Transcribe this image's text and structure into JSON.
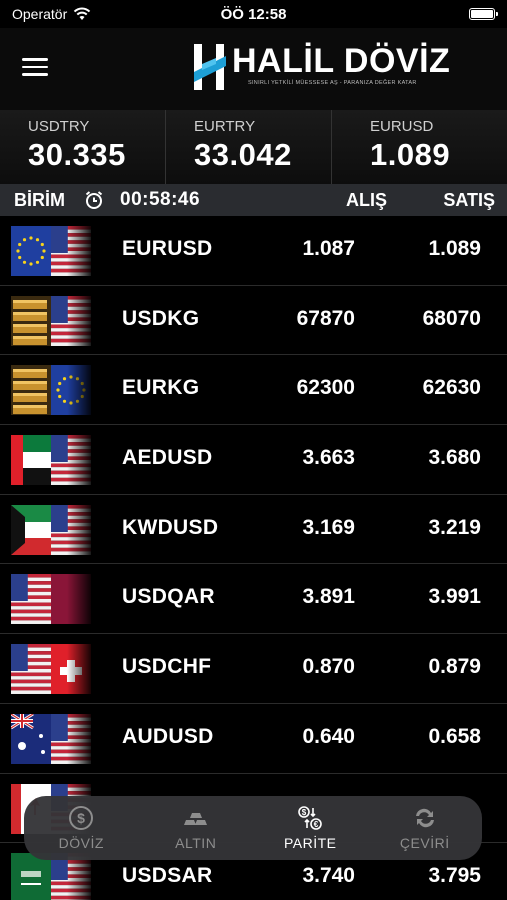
{
  "status_bar": {
    "carrier": "Operatör",
    "time": "ÖÖ 12:58"
  },
  "header": {
    "logo_title": "HALİL DÖVİZ",
    "logo_subtitle": "SINIRLI YETKİLİ MÜESSESE AŞ - PARANIZA DEĞER KATAR",
    "menu_icon": "hamburger-icon"
  },
  "ticker": [
    {
      "label": "USDTRY",
      "value": "30.335"
    },
    {
      "label": "EURTRY",
      "value": "33.042"
    },
    {
      "label": "EURUSD",
      "value": "1.089"
    }
  ],
  "table_header": {
    "unit": "BİRİM",
    "timer": "00:58:46",
    "buy": "ALIŞ",
    "sell": "SATIŞ"
  },
  "rows": [
    {
      "symbol": "EURUSD",
      "buy": "1.087",
      "sell": "1.089",
      "flag": "eu-us"
    },
    {
      "symbol": "USDKG",
      "buy": "67870",
      "sell": "68070",
      "flag": "gold-us"
    },
    {
      "symbol": "EURKG",
      "buy": "62300",
      "sell": "62630",
      "flag": "gold-eu"
    },
    {
      "symbol": "AEDUSD",
      "buy": "3.663",
      "sell": "3.680",
      "flag": "ae-us"
    },
    {
      "symbol": "KWDUSD",
      "buy": "3.169",
      "sell": "3.219",
      "flag": "kw-us"
    },
    {
      "symbol": "USDQAR",
      "buy": "3.891",
      "sell": "3.991",
      "flag": "us-qa"
    },
    {
      "symbol": "USDCHF",
      "buy": "0.870",
      "sell": "0.879",
      "flag": "us-ch"
    },
    {
      "symbol": "AUDUSD",
      "buy": "0.640",
      "sell": "0.658",
      "flag": "au-us"
    },
    {
      "symbol": "",
      "buy": "",
      "sell": "",
      "flag": "ca-us"
    },
    {
      "symbol": "USDSAR",
      "buy": "3.740",
      "sell": "3.795",
      "flag": "sa-us"
    }
  ],
  "tabs": [
    {
      "label": "DÖVİZ",
      "icon": "dollar-coin-icon",
      "active": false
    },
    {
      "label": "ALTIN",
      "icon": "gold-bars-icon",
      "active": false
    },
    {
      "label": "PARİTE",
      "icon": "currency-exchange-icon",
      "active": true
    },
    {
      "label": "ÇEVİRİ",
      "icon": "convert-arrows-icon",
      "active": false
    }
  ],
  "colors": {
    "background": "#000000",
    "tabbar": "#343437",
    "row_divider": "#2b2b2b",
    "header_row": "#2a2c30"
  }
}
